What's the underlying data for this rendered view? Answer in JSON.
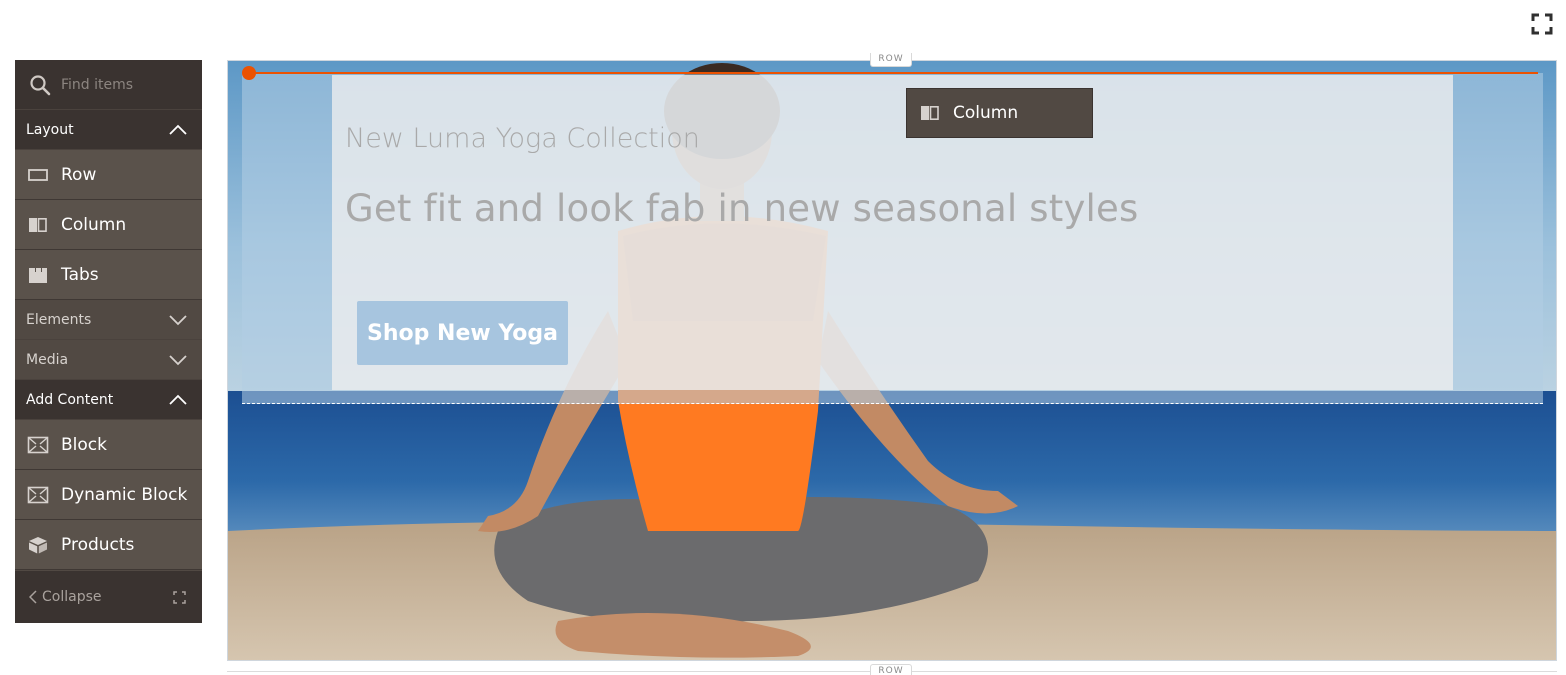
{
  "panel": {
    "search_placeholder": "Find items",
    "groups": [
      {
        "label": "Layout",
        "state": "expanded",
        "items": [
          {
            "label": "Row",
            "icon": "row-icon"
          },
          {
            "label": "Column",
            "icon": "column-icon"
          },
          {
            "label": "Tabs",
            "icon": "tabs-icon"
          }
        ]
      },
      {
        "label": "Elements",
        "state": "collapsed",
        "items": []
      },
      {
        "label": "Media",
        "state": "collapsed",
        "items": []
      },
      {
        "label": "Add Content",
        "state": "expanded",
        "items": [
          {
            "label": "Block",
            "icon": "block-icon"
          },
          {
            "label": "Dynamic Block",
            "icon": "dynamic-block-icon"
          },
          {
            "label": "Products",
            "icon": "products-icon"
          }
        ]
      }
    ],
    "collapse_label": "Collapse"
  },
  "stage": {
    "row_label": "ROW",
    "row_label_bottom": "ROW",
    "banner": {
      "subtitle": "New Luma Yoga Collection",
      "title": "Get fit and look fab in new seasonal styles",
      "button_label": "Shop New Yoga"
    },
    "drag_ghost": {
      "label": "Column",
      "icon": "column-icon"
    }
  },
  "colors": {
    "panel_bg": "#514943",
    "panel_dark": "#3a3330",
    "accent_orange": "#eb5202",
    "button_blue": "#a7c5df"
  }
}
